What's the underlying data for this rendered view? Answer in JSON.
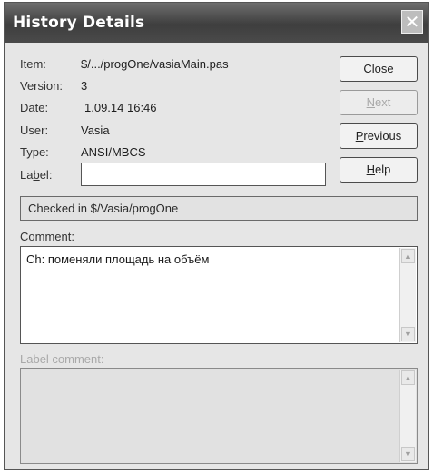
{
  "window": {
    "title": "History Details",
    "close_glyph": "✕"
  },
  "fields": {
    "item_label": "Item:",
    "item_value": "$/.../progOne/vasiaMain.pas",
    "version_label": "Version:",
    "version_value": "3",
    "date_label": "Date:",
    "date_value": "1.09.14 16:46",
    "user_label": "User:",
    "user_value": "Vasia",
    "type_label": "Type:",
    "type_value": "ANSI/MBCS",
    "label_label_pre": "La",
    "label_label_acc": "b",
    "label_label_post": "el:",
    "label_value": ""
  },
  "buttons": {
    "close": "Close",
    "next_acc": "N",
    "next_rest": "ext",
    "previous_acc": "P",
    "previous_rest": "revious",
    "help_acc": "H",
    "help_rest": "elp"
  },
  "status_text": "Checked in $/Vasia/progOne",
  "comment": {
    "label_pre": "Co",
    "label_acc": "m",
    "label_post": "ment:",
    "text": "Ch: поменяли площадь на объём"
  },
  "label_comment": {
    "label": "Label comment:",
    "text": ""
  },
  "icons": {
    "scroll_up": "▲",
    "scroll_down": "▼"
  }
}
